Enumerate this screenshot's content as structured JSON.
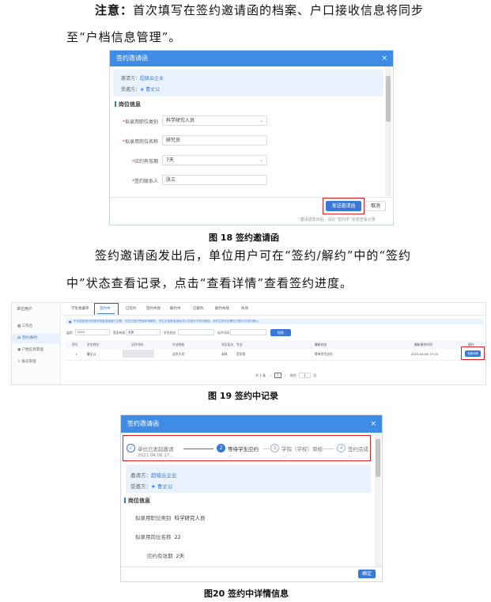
{
  "intro": {
    "note_label": "注意：",
    "line1_rest": "首次填写在签约邀请函的档案、户口接收信息将同步",
    "line2": "至“户档信息管理”。"
  },
  "fig18": {
    "dialog_title": "签约邀请函",
    "close_glyph": "×",
    "inviter_label": "邀请方：",
    "inviter_value": "超级云企业",
    "invitee_label": "受邀方：",
    "invitee_value": "★ 曹丈公",
    "section": "岗位信息",
    "fields": [
      {
        "label": "拟录用职位类别",
        "required": true,
        "value": "科学研究人员",
        "dropdown": true
      },
      {
        "label": "拟录用岗位名称",
        "required": true,
        "value": "研究员",
        "dropdown": false
      },
      {
        "label": "应约有效期",
        "required": true,
        "value": "7天",
        "dropdown": true
      },
      {
        "label": "签约联系人",
        "required": true,
        "value": "张三",
        "dropdown": false
      }
    ],
    "send_button": "发送邀请函",
    "cancel_button": "取消",
    "hint": "“邀请函发出后，请在“签约中”状态查看记录",
    "caption": "图 18 签约邀请函"
  },
  "middle": {
    "line1": "签约邀请函发出后，单位用户可在“签约/解约”中的“签约",
    "line2": "中”状态查看记录，点击“查看详情”查看签约进度。"
  },
  "fig19": {
    "user_label": "单位用户",
    "sidebar": [
      "工作台",
      "签约/解约",
      "户档信息管理",
      "账号管理"
    ],
    "sidebar_active": 1,
    "tabs": [
      "学生收藏单",
      "签约中",
      "已签约",
      "签约失败",
      "解约中",
      "已解约",
      "解约失败",
      "失效"
    ],
    "active_tab": 1,
    "notice": "不可发起签约的情况或者邀请函已过期，可在已签约界面申请解约，学生未接受邀请函可以在签约中进行撤回，待学生签约后需在已签约中进行确认。",
    "filters": {
      "year_label": "届别",
      "year_value": "2021",
      "valid_label": "是否有效",
      "valid_value": "全部",
      "name_label": "学生姓名",
      "cert_label": "证件号码",
      "search_button": "搜索"
    },
    "columns": [
      "序号",
      "学生姓名",
      "证件号码",
      "毕业院校",
      "学历层次",
      "专业",
      "最新状态",
      "最新操作时间",
      "操作"
    ],
    "rows": [
      {
        "index": "1",
        "name": "曹丈公",
        "id": "",
        "school": "北京大学",
        "level": "本科",
        "major": "哲学类",
        "status": "等待学生应约",
        "time": "2021.04.06 17:15",
        "action": "查看详情"
      }
    ],
    "pager": {
      "total": "共 1 条",
      "page": "1",
      "goto": "前往",
      "goto_value": "1",
      "unit": "页"
    },
    "caption": "图 19 签约中记录"
  },
  "fig20": {
    "dialog_title": "签约邀请函",
    "close_glyph": "×",
    "steps": [
      {
        "num": "✓",
        "label": "单位已发起邀请",
        "sub": "2021.04.06 17...",
        "state": "done"
      },
      {
        "num": "2",
        "label": "等待学生应约",
        "sub": "...",
        "state": "active"
      },
      {
        "num": "3",
        "label": "学院（学校）审核",
        "sub": "...",
        "state": "todo"
      },
      {
        "num": "4",
        "label": "签约完成",
        "sub": "...",
        "state": "todo"
      }
    ],
    "inviter_label": "邀请方：",
    "inviter_value": "超级云企业",
    "invitee_label": "受邀方：",
    "invitee_value": "★ 曹丈公",
    "section": "岗位信息",
    "items": [
      {
        "label": "拟录用职位类别",
        "value": "科学研究人员"
      },
      {
        "label": "拟录用岗位名称",
        "value": "22"
      },
      {
        "label": "应约有效期",
        "value": "2天"
      }
    ],
    "ok_button": "确定",
    "caption": "图20 签约中详情信息"
  }
}
